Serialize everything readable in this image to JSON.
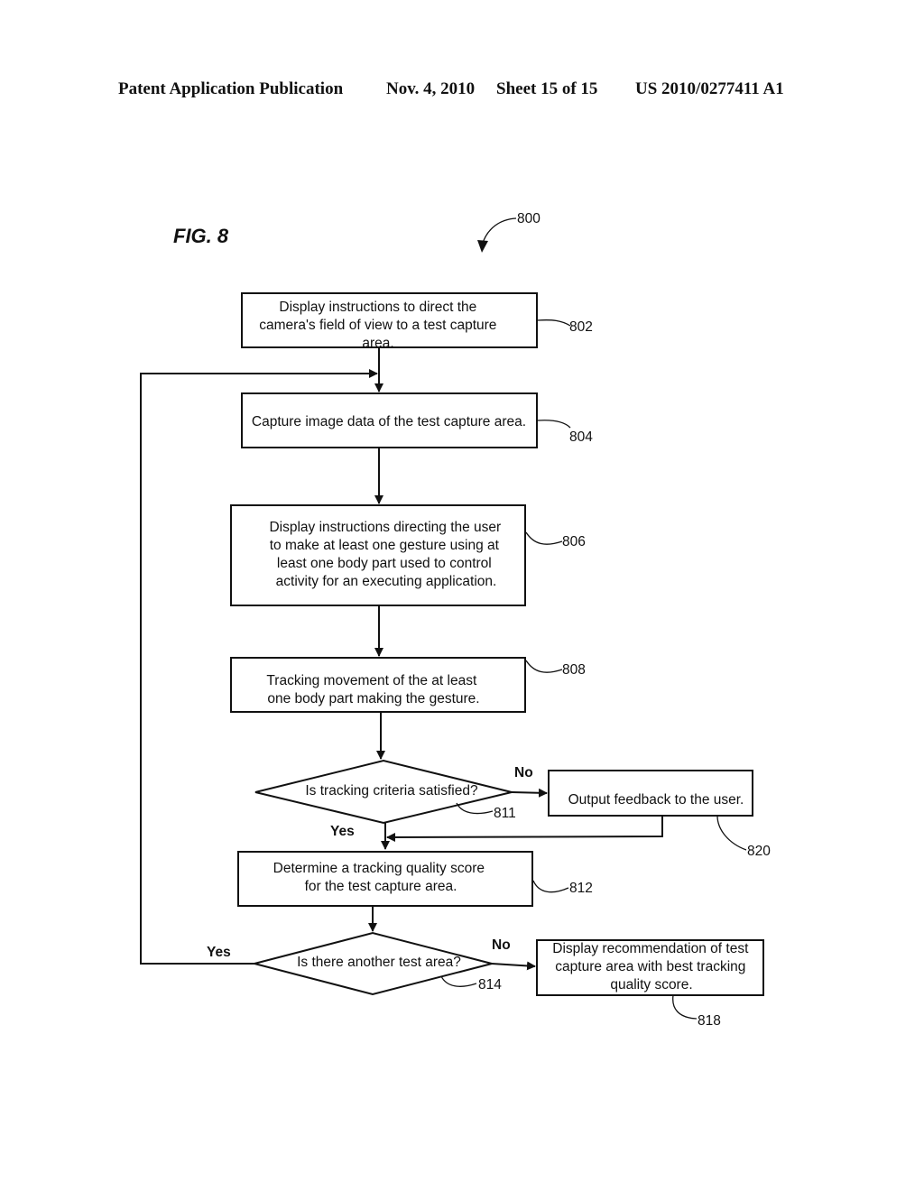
{
  "header": {
    "publication": "Patent Application Publication",
    "date": "Nov. 4, 2010",
    "sheet": "Sheet 15 of 15",
    "number": "US 2010/0277411 A1"
  },
  "figure": {
    "label": "FIG. 8",
    "ref": "800"
  },
  "nodes": {
    "n802": {
      "ref": "802",
      "type": "process",
      "lines": [
        "Display instructions to direct the",
        "camera's field of view to a test capture",
        "area."
      ]
    },
    "n804": {
      "ref": "804",
      "type": "process",
      "lines": [
        "Capture image data of the test capture area."
      ]
    },
    "n806": {
      "ref": "806",
      "type": "process",
      "lines": [
        "Display instructions directing the user",
        "to make at least one gesture using at",
        "least one body part used to control",
        "activity for an executing application."
      ]
    },
    "n808": {
      "ref": "808",
      "type": "process",
      "lines": [
        "Tracking movement of the at least",
        "one body part making the gesture."
      ]
    },
    "n811": {
      "ref": "811",
      "type": "decision",
      "lines": [
        "Is tracking criteria satisfied?"
      ]
    },
    "n820": {
      "ref": "820",
      "type": "process",
      "lines": [
        "Output feedback to the user."
      ]
    },
    "n812": {
      "ref": "812",
      "type": "process",
      "lines": [
        "Determine a tracking quality score",
        "for the test capture area."
      ]
    },
    "n814": {
      "ref": "814",
      "type": "decision",
      "lines": [
        "Is there another test area?"
      ]
    },
    "n818": {
      "ref": "818",
      "type": "process",
      "lines": [
        "Display recommendation of test",
        "capture area with best tracking",
        "quality score."
      ]
    }
  },
  "edges": {
    "e811_no": "No",
    "e811_yes": "Yes",
    "e814_no": "No",
    "e814_yes": "Yes"
  }
}
